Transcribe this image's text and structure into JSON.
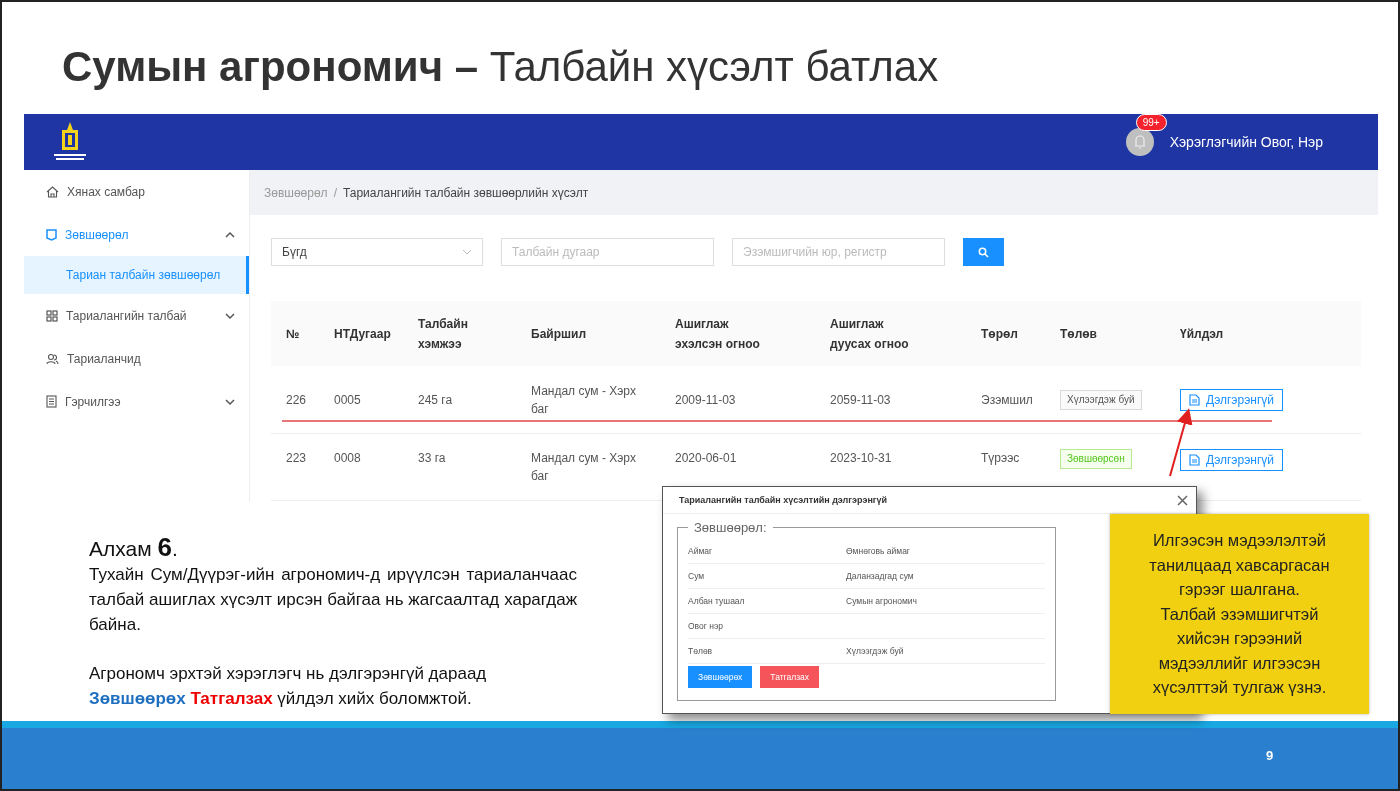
{
  "slide_title": "**Сумын агрономич –** Талбайн хүсэлт батлах",
  "app": {
    "header": {
      "notification_badge": "99+",
      "user_name": "Хэрэглэгчийн Овог, Нэр"
    },
    "sidebar": {
      "items": [
        {
          "label": "Хянах самбар",
          "selected": false
        },
        {
          "label": "Зөвшөөрөл",
          "selected": true,
          "expanded": true,
          "children": [
            {
              "label": "Тариан талбайн зөвшөөрөл",
              "selected": true
            }
          ]
        },
        {
          "label": "Тариалангийн талбай",
          "selected": false,
          "expanded": false
        },
        {
          "label": "Тариаланчид",
          "selected": false
        },
        {
          "label": "Гэрчилгээ",
          "selected": false,
          "expanded": false
        }
      ]
    },
    "breadcrumb": [
      "Зөвшөөрөл",
      "Тариалангийн талбайн зөвшөөрлийн хүсэлт"
    ],
    "breadcrumb_separator": "/",
    "filters": {
      "type_select": {
        "value": "Бүгд"
      },
      "field_number": {
        "placeholder": "Талбайн дугаар"
      },
      "owner": {
        "placeholder": "Эзэмшигчийн юр, регистр"
      }
    },
    "table": {
      "columns": [
        "№",
        "НТДугаар",
        "Талбайн хэмжээ",
        "Байршил",
        "Ашиглаж эхэлсэн огноо",
        "Ашиглаж дуусах огноо",
        "Төрөл",
        "Төлөв",
        "Үйлдэл"
      ],
      "rows": [
        {
          "no": "226",
          "nt": "0005",
          "size": "245 га",
          "location": "Мандал сум - Хэрх баг",
          "start": "2009-11-03",
          "end": "2059-11-03",
          "type": "Эзэмшил",
          "status": {
            "label": "Хүлээгдэж буй",
            "kind": "pending"
          },
          "action": "Дэлгэрэнгүй"
        },
        {
          "no": "223",
          "nt": "0008",
          "size": "33 га",
          "location": "Мандал сум - Хэрх баг",
          "start": "2020-06-01",
          "end": "2023-10-31",
          "type": "Түрээс",
          "status": {
            "label": "Зөвшөөрсөн",
            "kind": "approved"
          },
          "action": "Дэлгэрэнгүй"
        }
      ]
    }
  },
  "modal": {
    "title": "Тариалангийн талбайн хүсэлтийн дэлгэрэнгүй",
    "legend": "Зөвшөөрөл:",
    "fields": [
      {
        "label": "Аймаг",
        "value": "Өмнөговь аймаг"
      },
      {
        "label": "Сум",
        "value": "Даланзадгад сум"
      },
      {
        "label": "Албан тушаал",
        "value": "Сумын агрономич"
      },
      {
        "label": "Овог нэр"
      },
      {
        "label": "Төлөв",
        "value": "Хүлээгдэж буй"
      }
    ],
    "buttons": [
      {
        "label": "Зөвшөөрөх",
        "kind": "primary"
      },
      {
        "label": "Татгалзах",
        "kind": "danger"
      }
    ]
  },
  "step": {
    "heading": "Алхам **6**.",
    "paragraphs": [
      "Тухайн Сум/Дүүрэг-ийн агрономич-д ирүүлсэн тариаланчаас талбай ашиглах хүсэлт ирсэн байгаа нь жагсаалтад харагдаж байна.",
      "Агрономч эрхтэй хэрэглэгч нь дэлгэрэнгүй дараад **Зөвшөөрөх**  **Татгалзах** үйлдэл хийх боломжтой."
    ]
  },
  "note": "Илгээсэн мэдээлэлтэй танилцаад хавсаргасан гэрээг шалгана.\nТалбай эзэмшигчтэй хийсэн гэрээний мэдээллийг илгээсэн хүсэлттэй тулгаж үзнэ.",
  "page_number": "9"
}
